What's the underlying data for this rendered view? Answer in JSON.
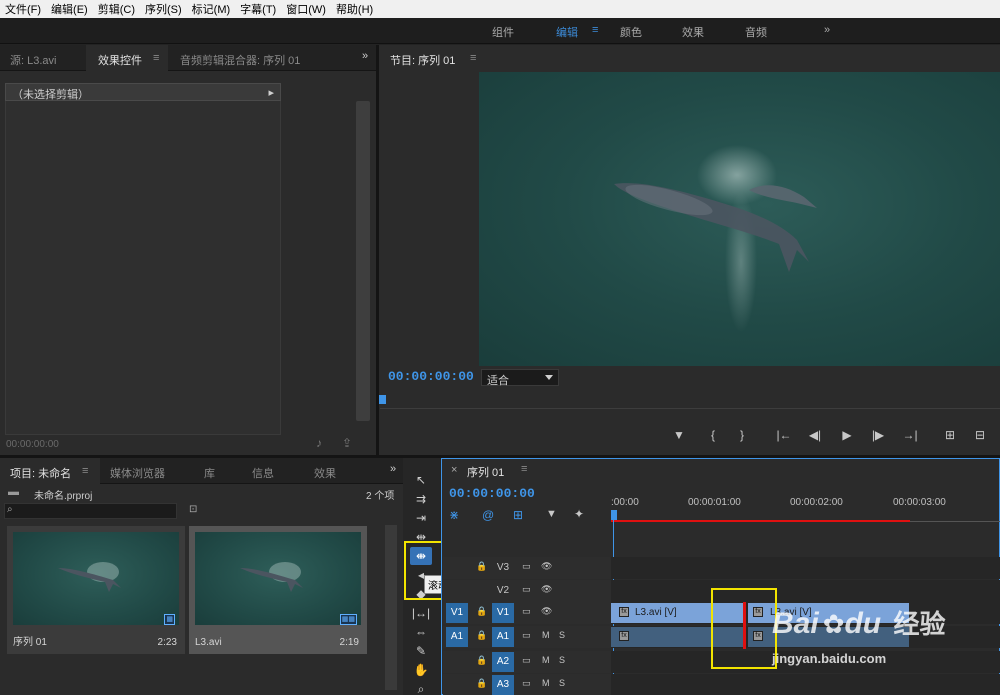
{
  "menubar": [
    "文件(F)",
    "编辑(E)",
    "剪辑(C)",
    "序列(S)",
    "标记(M)",
    "字幕(T)",
    "窗口(W)",
    "帮助(H)"
  ],
  "workspaces": {
    "items": [
      "组件",
      "编辑",
      "颜色",
      "效果",
      "音频"
    ],
    "active": "编辑",
    "more": "»"
  },
  "source_panel": {
    "tabs": [
      "源: L3.avi",
      "效果控件",
      "音频剪辑混合器: 序列 01"
    ],
    "active_tab": "效果控件",
    "no_clip": "（未选择剪辑）",
    "timecode": "00:00:00:00"
  },
  "program_panel": {
    "title": "节目: 序列 01",
    "timecode": "00:00:00:00",
    "fit": "适合"
  },
  "project_panel": {
    "tabs": [
      "项目: 未命名",
      "媒体浏览器",
      "库",
      "信息",
      "效果"
    ],
    "active_tab": "项目: 未命名",
    "project_file": "未命名.prproj",
    "item_count": "2 个项",
    "items": [
      {
        "name": "序列 01",
        "duration": "2:23",
        "badge": "seq"
      },
      {
        "name": "L3.avi",
        "duration": "2:19",
        "badge": "avi"
      }
    ]
  },
  "tools": {
    "tooltip": "滚动编辑工具 (N)"
  },
  "timeline": {
    "tab": "序列 01",
    "timecode": "00:00:00:00",
    "ticks": [
      ":00:00",
      "00:00:01:00",
      "00:00:02:00",
      "00:00:03:00"
    ],
    "tracks": [
      {
        "name": "V3",
        "kind": "video"
      },
      {
        "name": "V2",
        "kind": "video"
      },
      {
        "name": "V1",
        "kind": "video",
        "source": "V1"
      },
      {
        "name": "A1",
        "kind": "audio",
        "source": "A1"
      },
      {
        "name": "A2",
        "kind": "audio"
      },
      {
        "name": "A3",
        "kind": "audio"
      }
    ],
    "clips": {
      "v1_a": "L3.avi [V]",
      "v1_b": "L3.avi [V]"
    },
    "fx": "fx"
  },
  "watermark": {
    "brand": "Bai",
    "paw": "du",
    "cn": "经验",
    "url": "jingyan.baidu.com"
  },
  "colors": {
    "accent_blue": "#3c8bd8",
    "timecode_blue": "#3f95e8",
    "highlight_yellow": "#f2e400",
    "edit_red": "#e01010"
  }
}
